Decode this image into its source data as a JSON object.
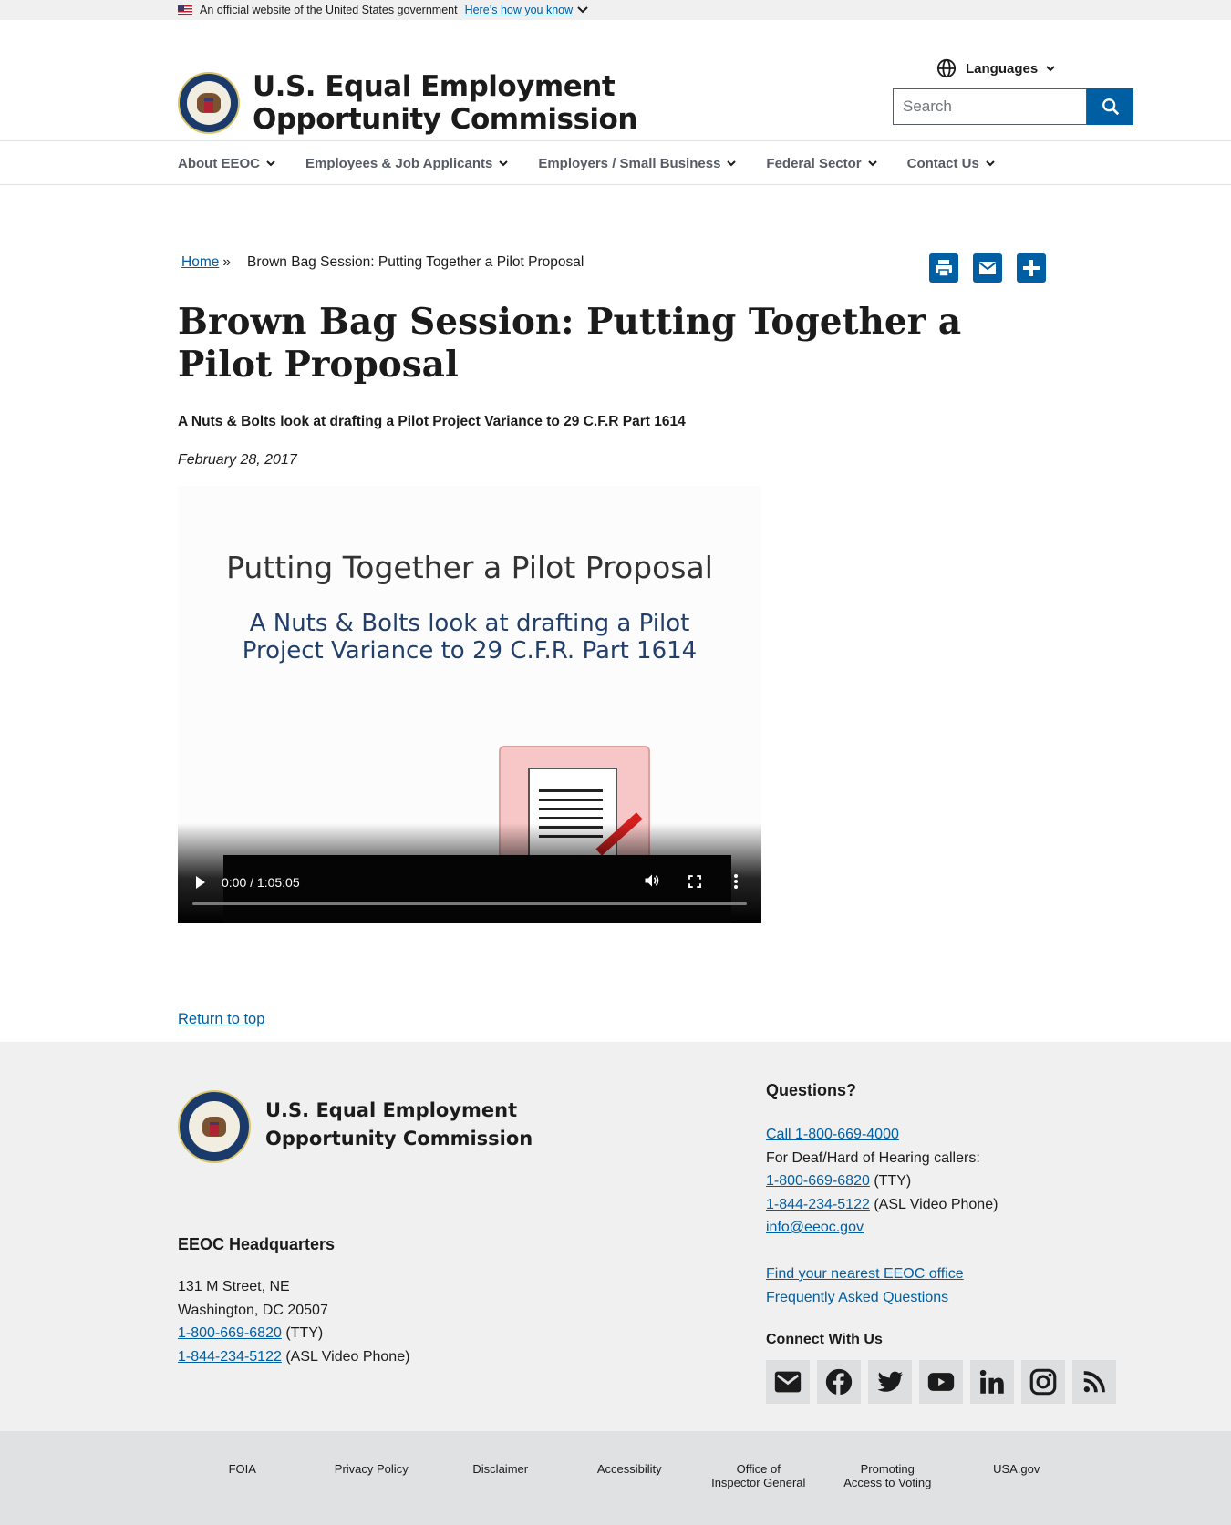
{
  "banner": {
    "text": "An official website of the United States government",
    "link": "Here’s how you know"
  },
  "header": {
    "site_title": "U.S. Equal Employment Opportunity Commission",
    "languages_label": "Languages",
    "search_placeholder": "Search"
  },
  "nav": {
    "items": [
      {
        "label": "About EEOC"
      },
      {
        "label": "Employees & Job Applicants"
      },
      {
        "label": "Employers / Small Business"
      },
      {
        "label": "Federal Sector"
      },
      {
        "label": "Contact Us"
      }
    ]
  },
  "breadcrumb": {
    "home": "Home",
    "separator": "»",
    "current": "Brown Bag Session: Putting Together a Pilot Proposal"
  },
  "page": {
    "title": "Brown Bag Session: Putting Together a Pilot Proposal",
    "subtitle": "A Nuts & Bolts look at drafting a Pilot Project Variance to 29 C.F.R Part 1614",
    "date": "February 28, 2017"
  },
  "video": {
    "slide_title": "Putting Together a Pilot Proposal",
    "slide_subtitle_line1": "A Nuts & Bolts look at drafting a Pilot",
    "slide_subtitle_line2": "Project Variance to 29 C.F.R. Part 1614",
    "time": "0:00 / 1:05:05",
    "progress": 0
  },
  "return_top": "Return to top",
  "footer": {
    "title_line1": "U.S. Equal Employment",
    "title_line2": "Opportunity Commission",
    "hq_heading": "EEOC Headquarters",
    "address_line1": "131 M Street, NE",
    "address_line2": "Washington, DC 20507",
    "tty_phone": "1-800-669-6820",
    "tty_suffix": "(TTY)",
    "asl_phone": "1-844-234-5122",
    "asl_suffix": "(ASL Video Phone)",
    "questions_heading": "Questions?",
    "call": "Call 1-800-669-4000",
    "deaf_text": "For Deaf/Hard of Hearing callers:",
    "email": "info@eeoc.gov",
    "find_office": "Find your nearest EEOC office",
    "faq": "Frequently Asked Questions",
    "connect_heading": "Connect With Us",
    "social": [
      "email-icon",
      "facebook-icon",
      "twitter-icon",
      "youtube-icon",
      "linkedin-icon",
      "instagram-icon",
      "rss-icon"
    ]
  },
  "bottom_links": [
    "FOIA",
    "Privacy Policy",
    "Disclaimer",
    "Accessibility",
    "Office of\nInspector General",
    "Promoting\nAccess to Voting",
    "USA.gov"
  ],
  "colors": {
    "link": "#005ea2",
    "primary": "#005ea2",
    "footer_bg": "#f0f0f0",
    "bottom_bg": "#dfe1e2"
  }
}
